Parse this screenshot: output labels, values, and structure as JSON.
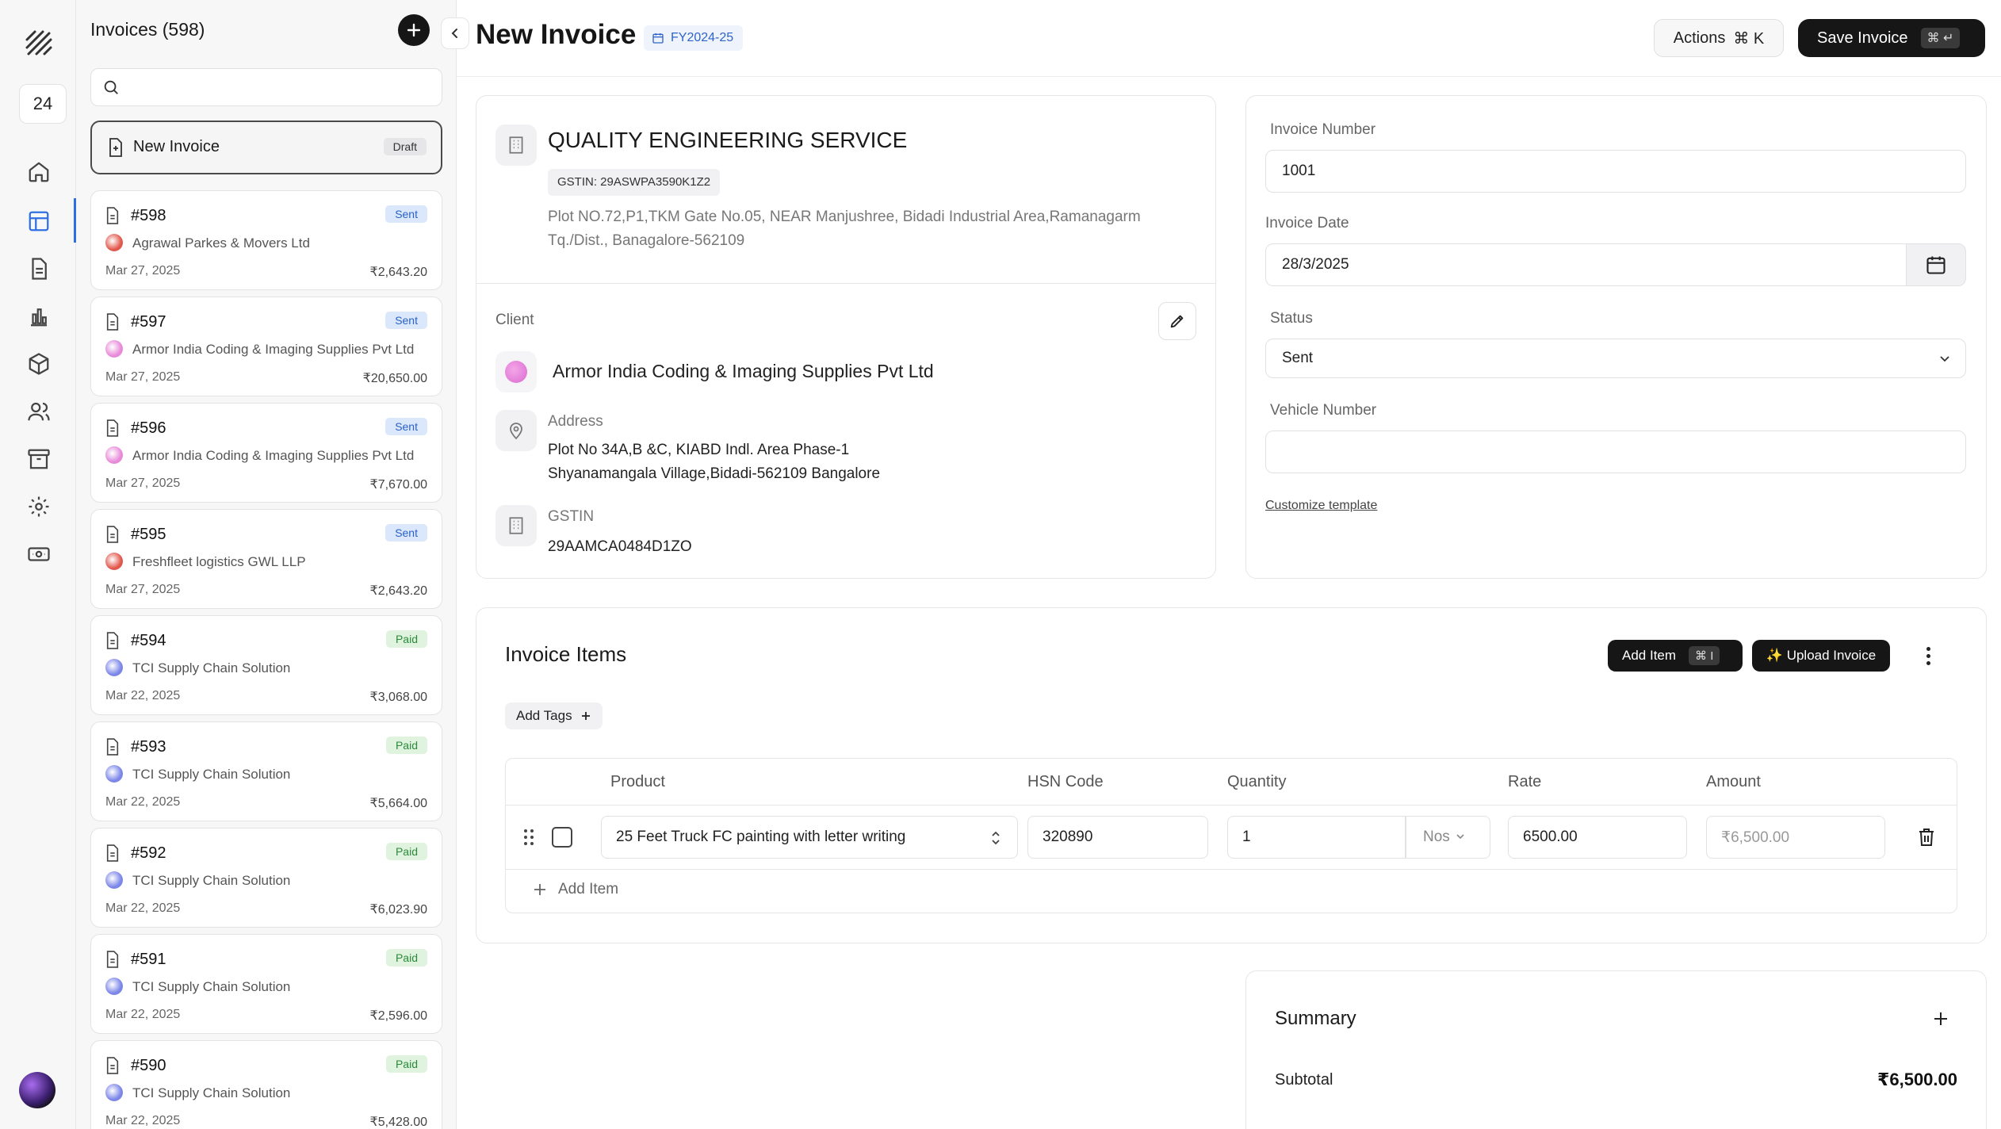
{
  "rail": {
    "day_badge": "24"
  },
  "list": {
    "title": "Invoices (598)",
    "search_placeholder": "",
    "new_invoice": {
      "label": "New Invoice",
      "badge": "Draft"
    },
    "invoices": [
      {
        "number": "#598",
        "status": "Sent",
        "client": "Agrawal Parkes & Movers Ltd",
        "date": "Mar 27, 2025",
        "amount": "₹2,643.20",
        "dot_color": "#e2574c"
      },
      {
        "number": "#597",
        "status": "Sent",
        "client": "Armor India Coding & Imaging Supplies Pvt Ltd",
        "date": "Mar 27, 2025",
        "amount": "₹20,650.00",
        "dot_color": "#e889d9"
      },
      {
        "number": "#596",
        "status": "Sent",
        "client": "Armor India Coding & Imaging Supplies Pvt Ltd",
        "date": "Mar 27, 2025",
        "amount": "₹7,670.00",
        "dot_color": "#e889d9"
      },
      {
        "number": "#595",
        "status": "Sent",
        "client": "Freshfleet logistics GWL LLP",
        "date": "Mar 27, 2025",
        "amount": "₹2,643.20",
        "dot_color": "#e2574c"
      },
      {
        "number": "#594",
        "status": "Paid",
        "client": "TCI Supply Chain Solution",
        "date": "Mar 22, 2025",
        "amount": "₹3,068.00",
        "dot_color": "#7b86e8"
      },
      {
        "number": "#593",
        "status": "Paid",
        "client": "TCI Supply Chain Solution",
        "date": "Mar 22, 2025",
        "amount": "₹5,664.00",
        "dot_color": "#7b86e8"
      },
      {
        "number": "#592",
        "status": "Paid",
        "client": "TCI Supply Chain Solution",
        "date": "Mar 22, 2025",
        "amount": "₹6,023.90",
        "dot_color": "#7b86e8"
      },
      {
        "number": "#591",
        "status": "Paid",
        "client": "TCI Supply Chain Solution",
        "date": "Mar 22, 2025",
        "amount": "₹2,596.00",
        "dot_color": "#7b86e8"
      },
      {
        "number": "#590",
        "status": "Paid",
        "client": "TCI Supply Chain Solution",
        "date": "Mar 22, 2025",
        "amount": "₹5,428.00",
        "dot_color": "#7b86e8"
      }
    ]
  },
  "header": {
    "title": "New Invoice",
    "fiscal_year": "FY2024-25",
    "actions_label": "Actions",
    "actions_shortcut": "⌘ K",
    "save_label": "Save Invoice",
    "save_shortcut": "⌘ ↵"
  },
  "company": {
    "name": "QUALITY ENGINEERING SERVICE",
    "gstin": "GSTIN: 29ASWPA3590K1Z2",
    "address_line1": "Plot NO.72,P1,TKM Gate No.05, NEAR Manjushree, Bidadi Industrial Area,Ramanagarm",
    "address_line2": "Tq./Dist., Banagalore-562109"
  },
  "client": {
    "section_label": "Client",
    "name": "Armor India Coding & Imaging Supplies Pvt Ltd",
    "address_label": "Address",
    "address_line1": "Plot No 34A,B &C, KIABD Indl. Area Phase-1",
    "address_line2": "Shyanamangala Village,Bidadi-562109 Bangalore",
    "gstin_label": "GSTIN",
    "gstin": "29AAMCA0484D1ZO"
  },
  "meta": {
    "invoice_number_label": "Invoice Number",
    "invoice_number": "1001",
    "invoice_date_label": "Invoice Date",
    "invoice_date": "28/3/2025",
    "status_label": "Status",
    "status": "Sent",
    "vehicle_label": "Vehicle Number",
    "vehicle_value": "",
    "customize_link": "Customize template"
  },
  "items": {
    "title": "Invoice Items",
    "add_item_btn": "Add Item",
    "add_item_shortcut": "⌘ I",
    "upload_btn": "✨ Upload Invoice",
    "add_tags": "Add Tags",
    "columns": {
      "product": "Product",
      "hsn": "HSN Code",
      "quantity": "Quantity",
      "rate": "Rate",
      "amount": "Amount"
    },
    "rows": [
      {
        "product": "25 Feet Truck FC painting with letter writing",
        "hsn": "320890",
        "quantity": "1",
        "unit": "Nos",
        "rate": "6500.00",
        "amount": "₹6,500.00"
      }
    ],
    "add_row_label": "Add Item"
  },
  "summary": {
    "title": "Summary",
    "subtotal_label": "Subtotal",
    "subtotal": "₹6,500.00"
  },
  "colors": {
    "accent": "#2f6fe4",
    "dark_button": "#161616"
  }
}
